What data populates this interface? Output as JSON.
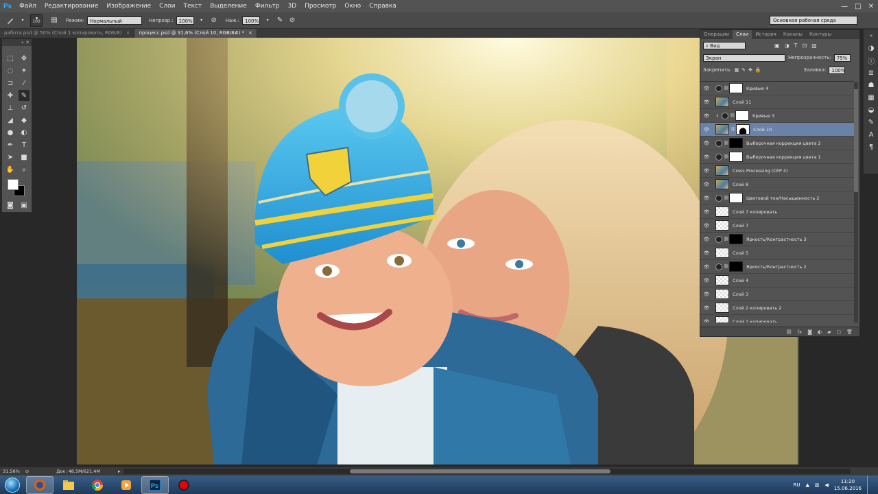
{
  "menubar": {
    "logo": "Ps",
    "items": [
      "Файл",
      "Редактирование",
      "Изображение",
      "Слои",
      "Текст",
      "Выделение",
      "Фильтр",
      "3D",
      "Просмотр",
      "Окно",
      "Справка"
    ],
    "window_controls": [
      "—",
      "□",
      "✕"
    ]
  },
  "options": {
    "brush_size": "100",
    "mode_label": "Режим:",
    "mode_value": "Нормальный",
    "opacity_label": "Непрозр.:",
    "opacity_value": "100%",
    "flow_label": "Наж.:",
    "flow_value": "100%",
    "workspace": "Основная рабочая среда"
  },
  "tabs": [
    {
      "label": "работа.psd @ 50% (Слой 1 копировать, RGB/8)",
      "close": "×"
    },
    {
      "label": "процесс.psd @ 31,6% (Слой 10, RGB/8#) *",
      "close": "×"
    }
  ],
  "panel": {
    "tabs": [
      "Операции",
      "Слои",
      "История",
      "Каналы",
      "Контуры"
    ],
    "active_tab": "Слои",
    "filter_value": "Вид",
    "blend_mode": "Экран",
    "opacity_label": "Непрозрачность:",
    "opacity_value": "75%",
    "lock_label": "Закрепить:",
    "fill_label": "Заливка:",
    "fill_value": "100%",
    "layers": [
      {
        "name": "Кривые 4",
        "kind": "adjustment",
        "mask": "white"
      },
      {
        "name": "Слой 11",
        "kind": "image"
      },
      {
        "name": "Кривые 3",
        "kind": "adjustment-clipped",
        "mask": "white"
      },
      {
        "name": "Слой 10",
        "kind": "image-mask",
        "mask": "black",
        "selected": true
      },
      {
        "name": "Выборочная коррекция цвета 2",
        "kind": "adjustment",
        "mask": "black"
      },
      {
        "name": "Выборочная коррекция цвета 1",
        "kind": "adjustment",
        "mask": "white"
      },
      {
        "name": "Cross Processing (CEP 4)",
        "kind": "image"
      },
      {
        "name": "Слой 8",
        "kind": "image"
      },
      {
        "name": "Цветовой тон/Насыщенность 2",
        "kind": "adjustment",
        "mask": "white"
      },
      {
        "name": "Слой 7 копировать",
        "kind": "transparent"
      },
      {
        "name": "Слой 7",
        "kind": "transparent"
      },
      {
        "name": "Яркость/Контрастность 3",
        "kind": "adjustment",
        "mask": "black"
      },
      {
        "name": "Слой 5",
        "kind": "transparent"
      },
      {
        "name": "Яркость/Контрастность 2",
        "kind": "adjustment",
        "mask": "black"
      },
      {
        "name": "Слой 4",
        "kind": "transparent"
      },
      {
        "name": "Слой 3",
        "kind": "transparent"
      },
      {
        "name": "Слой 2 копировать 2",
        "kind": "transparent"
      },
      {
        "name": "Слой 2 копировать",
        "kind": "transparent"
      }
    ],
    "footer_icons": [
      "link-icon",
      "fx-icon",
      "mask-icon",
      "adjustment-icon",
      "folder-icon",
      "new-layer-icon",
      "trash-icon"
    ]
  },
  "status": {
    "zoom": "31,56%",
    "doc": "Док: 48,5M/621,4M"
  },
  "taskbar": {
    "apps": [
      "firefox",
      "explorer",
      "chrome",
      "media-player",
      "photoshop",
      "recorder"
    ],
    "lang": "RU",
    "time": "11:20",
    "date": "15.06.2016"
  },
  "colors": {
    "ps_blue": "#31a8ff",
    "panel_bg": "#535353",
    "selected_layer": "#6b82a8"
  }
}
